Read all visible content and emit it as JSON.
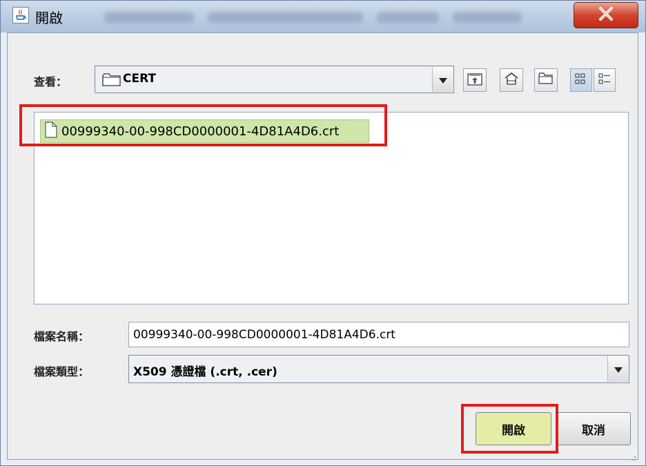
{
  "window": {
    "title": "開啟",
    "close_label": "X"
  },
  "lookin": {
    "label": "查看：",
    "value": "CERT"
  },
  "toolbar": {
    "up_icon": "up-folder-icon",
    "home_icon": "home-icon",
    "new_folder_icon": "new-folder-icon",
    "list_view_icon": "list-view-icon",
    "details_view_icon": "details-view-icon"
  },
  "files": [
    {
      "name": "00999340-00-998CD0000001-4D81A4D6.crt",
      "selected": true
    }
  ],
  "filename": {
    "label": "檔案名稱：",
    "value": "00999340-00-998CD0000001-4D81A4D6.crt"
  },
  "filetype": {
    "label": "檔案類型：",
    "value": "X509 憑證檔 (.crt, .cer)"
  },
  "buttons": {
    "open": "開啟",
    "cancel": "取消"
  },
  "colors": {
    "highlight_box": "#e31b1b",
    "selected_item": "#d0e6a9",
    "close_button": "#c8341e"
  }
}
